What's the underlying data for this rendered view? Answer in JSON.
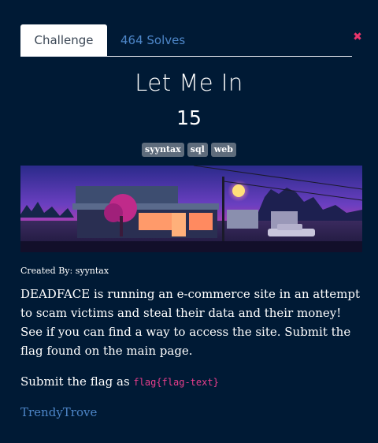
{
  "tabs": {
    "challenge": "Challenge",
    "solves": "464 Solves"
  },
  "close_icon": "✖",
  "challenge": {
    "name": "Let Me In",
    "points": "15",
    "tags": [
      "syyntax",
      "sql",
      "web"
    ],
    "created_by": "Created By: syyntax",
    "description": "DEADFACE is running an e-commerce site in an attempt to scam victims and steal their data and their money! See if you can find a way to access the site. Submit the flag found on the main page.",
    "submit_prefix": "Submit the flag as ",
    "flag_format": "flag{flag-text}",
    "link_text": "TrendyTrove"
  },
  "colors": {
    "background": "#001a35",
    "link": "#4d86c8",
    "close": "#e8356b",
    "code": "#e83e8c"
  },
  "icons": {
    "close": "close-icon"
  }
}
